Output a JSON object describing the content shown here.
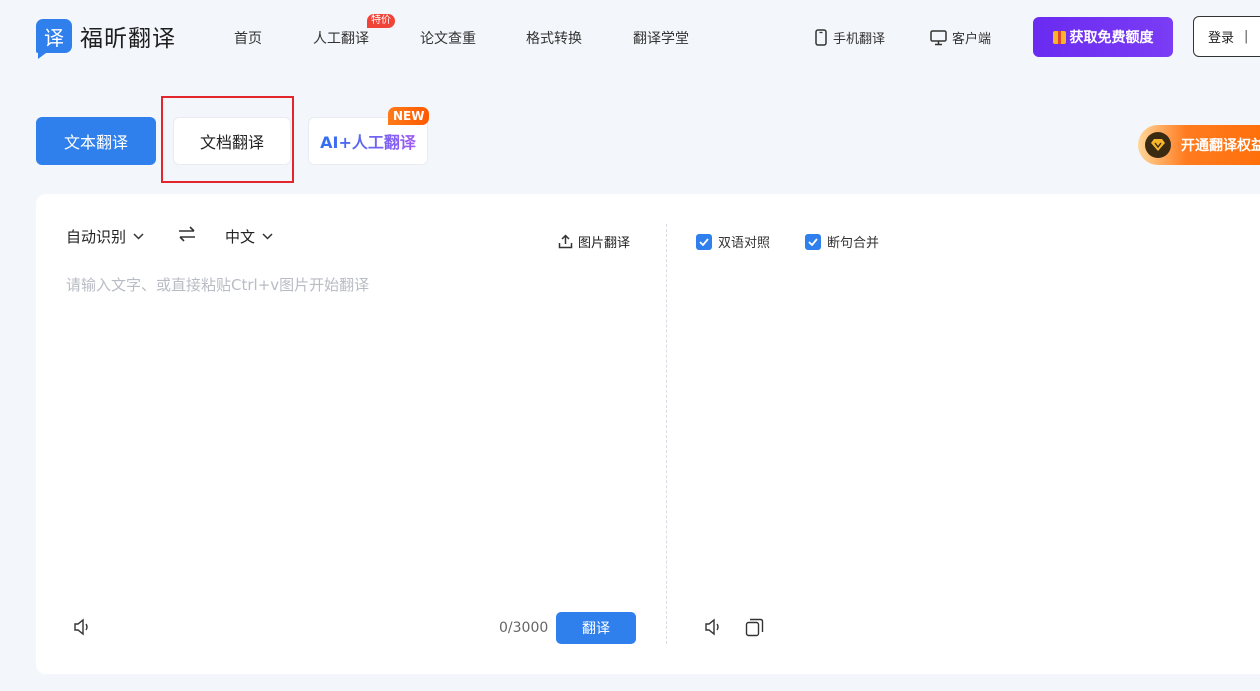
{
  "logo": {
    "badge": "译",
    "name": "福昕翻译"
  },
  "nav": [
    {
      "label": "首页"
    },
    {
      "label": "人工翻译",
      "tag": "特价"
    },
    {
      "label": "论文查重"
    },
    {
      "label": "格式转换"
    },
    {
      "label": "翻译学堂"
    }
  ],
  "header_right": {
    "mobile": "手机翻译",
    "client": "客户端",
    "promo": "获取免费额度",
    "login": "登录",
    "login_sep": "|"
  },
  "tabs": {
    "text": "文本翻译",
    "document": "文档翻译",
    "ai": "AI+人工翻译",
    "new_badge": "NEW"
  },
  "vip_banner": "开通翻译权益",
  "source": {
    "lang": "自动识别",
    "target_lang": "中文",
    "image_translate": "图片翻译",
    "placeholder": "请输入文字、或直接粘贴Ctrl+v图片开始翻译",
    "counter": "0/3000",
    "translate_button": "翻译"
  },
  "target": {
    "bilingual": "双语对照",
    "merge": "断句合并"
  },
  "colors": {
    "accent": "#2f80ed",
    "promo": "#6a2bf1",
    "highlight": "#e3262b",
    "orange": "#ff6a00"
  }
}
